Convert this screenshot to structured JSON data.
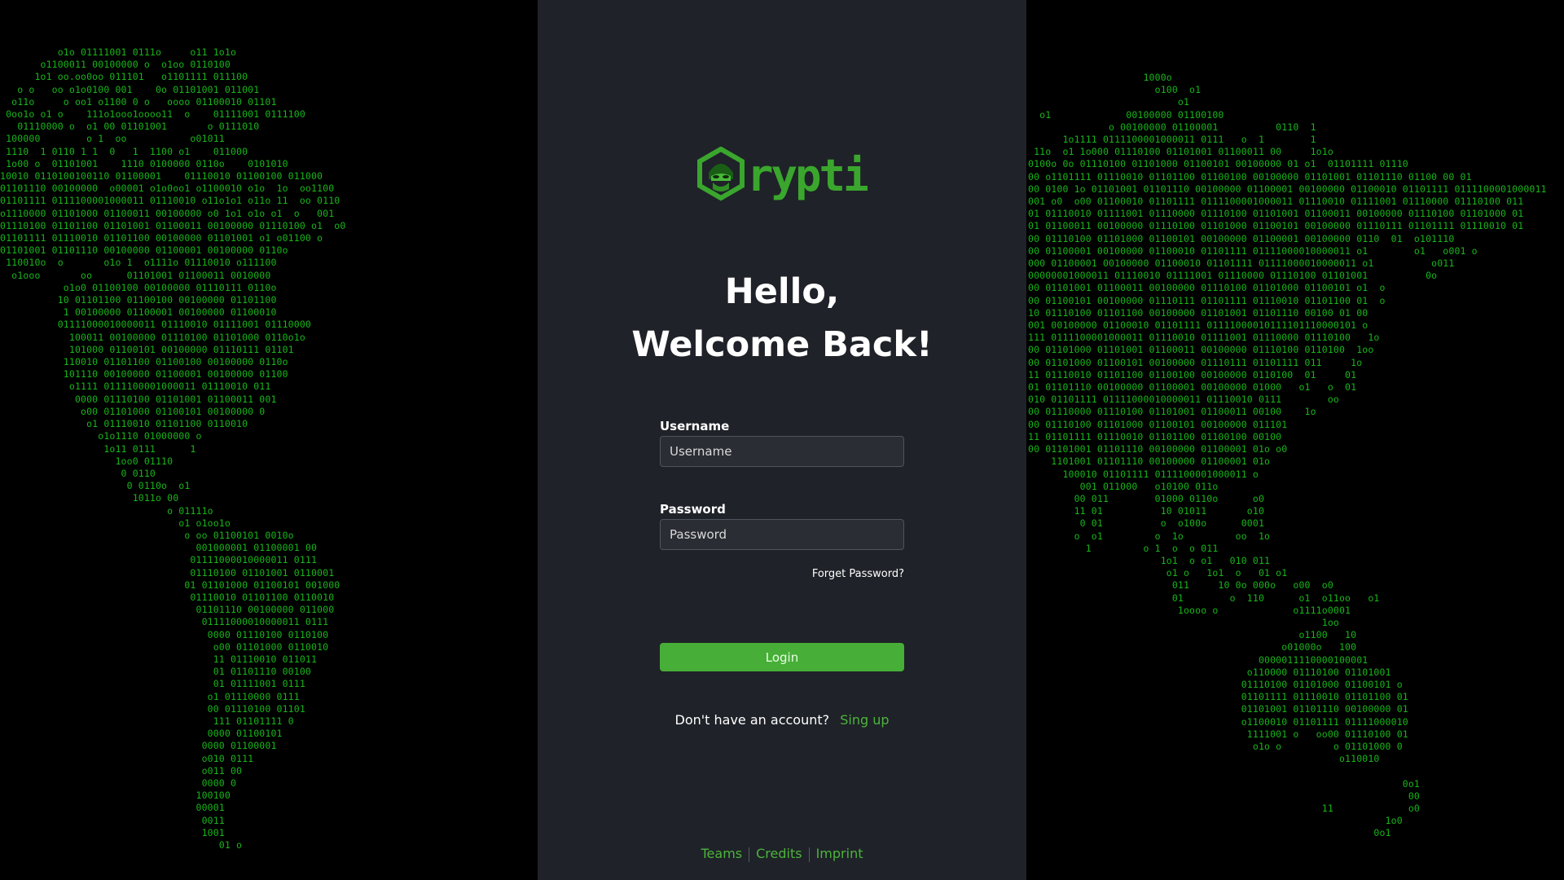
{
  "app": {
    "logo_text": "Cryptic",
    "accent_color": "#47ae37"
  },
  "greeting": {
    "line1": "Hello,",
    "line2": "Welcome Back!"
  },
  "form": {
    "username_label": "Username",
    "username_placeholder": "Username",
    "username_value": "",
    "password_label": "Password",
    "password_placeholder": "Password",
    "password_value": "",
    "forget_password": "Forget Password?",
    "login_label": "Login"
  },
  "signup": {
    "prompt": "Don't have an account?",
    "link": "Sing up"
  },
  "footer": {
    "links": [
      "Teams",
      "Credits",
      "Imprint"
    ]
  },
  "background": {
    "left_binary": [
      "          o1o 01111001 0111o     o11 1o1o",
      "       o1100011 00100000 o  o1oo 0110100",
      "      1o1 oo.oo0oo 011101   o1101111 011100",
      "   o o   oo o1o0100 001    0o 01101001 011001",
      "  o11o     o oo1 o1100 0 o   oooo 01100010 01101",
      " 0oo1o o1 o    111o1ooo1oooo11  o    01111001 0111100",
      "   01110000 o  o1 00 01101001       o 0111010",
      " 100000        o 1  oo           o01011",
      " 1110  1 0110 1 1  0   1  1100 o1    011000",
      " 1o00 o  01101001    1110 0100000 0110o    0101010",
      "10010 0110100100110 01100001    01110010 01100100 011000",
      "01101110 00100000  o00001 o1o0oo1 o1100010 o1o  1o  oo1100",
      "01101111 0111100001000011 01110010 o11o1o1 o11o 11  oo 0110",
      "o1110000 01101000 01100011 00100000 o0 1o1 o1o o1  o   001",
      "01110100 01101100 01101001 01100011 00100000 01110100 o1  o0",
      "01101111 01110010 01101100 00100000 01101001 o1 o01100 o",
      "01101001 01101110 00100000 01100001 00100000 0110o",
      " 110010o  o       o1o 1  o1111o 01110010 o111100",
      "  o1ooo       oo      01101001 01100011 0010000",
      "           o1o0 01100100 00100000 01110111 0110o",
      "          10 01101100 01100100 00100000 01101100",
      "           1 00100000 01100001 00100000 01100010",
      "          01111000010000011 01110010 01111001 01110000",
      "            100011 00100000 01110100 01101000 0110o1o",
      "            101000 01100101 00100000 01110111 01101",
      "           110010 01101100 01100100 00100000 0110o",
      "           101110 00100000 01100001 00100000 01100",
      "            o1111 0111100001000011 01110010 011",
      "             0000 01110100 01101001 01100011 001",
      "              o00 01101000 01100101 00100000 0",
      "               o1 01110010 01101100 0110010",
      "                 o1o1110 01000000 o",
      "                  1o11 0111      1",
      "                    1oo0 01110",
      "                     0 0110",
      "                      0 0110o  o1",
      "                       1011o 00",
      "                             o 01111o",
      "                               o1 o1oo1o",
      "                                o oo 01100101 0010o",
      "                                  001000001 01100001 00",
      "                                 01111000010000011 0111",
      "                                 01110100 01101001 0110001",
      "                                01 01101000 01100101 001000",
      "                                 01110010 01101100 0110010",
      "                                  01101110 00100000 011000",
      "                                   01111000010000011 0111",
      "                                    0000 01110100 0110100",
      "                                     o00 01101000 0110010",
      "                                     11 01110010 011011",
      "                                     01 01101110 00100",
      "                                     01 01111001 0111",
      "                                    o1 01110000 0111",
      "                                    00 01110100 01101",
      "                                     111 01101111 0",
      "                                    0000 01100101",
      "                                   0000 01100001",
      "                                   o010 0111",
      "                                   o011 00",
      "                                   0000 0",
      "                                  100100",
      "                                  00001",
      "                                   0011",
      "                                   1001",
      "                                      01 o"
    ],
    "right_binary": [
      "                    1000o",
      "                      o100  o1",
      "                          o1",
      "  o1             00100000 01100100",
      "              o 00100000 01100001          0110  1",
      "      1o1111 0111100001000011 0111   o  1        1",
      " 11o  o1 1o000 01110100 01101001 01100011 00     1o1o",
      "0100o 0o 01110100 01101000 01100101 00100000 01 o1  01101111 01110  ",
      "00 o1101111 01110010 01101100 01100100 00100000 01101001 01101110 01100 00 01",
      "00 0100 1o 01101001 01101110 00100000 01100001 00100000 01100010 01101111 0111100001000011",
      "001 o0  o00 01100010 01101111 0111100001000011 01110010 01111001 01110000 01110100 011",
      "01 01110010 01111001 01110000 01110100 01101001 01100011 00100000 01110100 01101000 01",
      "01 01100011 00100000 01110100 01101000 01100101 00100000 01110111 01101111 01110010 01",
      "00 01110100 01101000 01100101 00100000 01100001 00100000 0110  01  o101110",
      "00 01100001 00100000 01100010 01101111 01111000010000011 o1        o1   o001 o",
      "000 01100001 00100000 01100010 01101111 01111000010000011 o1          o011",
      "00000001000011 01110010 01111001 01110000 01110100 01101001          0o",
      "00 01101001 01100011 00100000 01110100 01101000 01100101 o1  o",
      "00 01100101 00100000 01110111 01101111 01110010 01101100 01  o",
      "10 01110100 01101100 00100000 01101001 01101110 00100 01 00",
      "001 00100000 01100010 01101111 01111000010111101110000101 o",
      "111 0111100001000011 01110010 01111001 01110000 01110100   1o",
      "00 01101000 01101001 01100011 00100000 01110100 0110100  1oo",
      "00 01101000 01100101 00100000 01110111 01101111 011     1o",
      "11 01110010 01101100 01100100 00100000 0110100  01     01",
      "01 01101110 00100000 01100001 00100000 01000   o1   o  01",
      "010 01101111 01111000010000011 01110010 0111        oo",
      "00 01110000 01110100 01101001 01100011 00100    1o",
      "00 01110100 01101000 01100101 00100000 011101",
      "11 01101111 01110010 01101100 01100100 00100",
      "00 01101001 01101110 00100000 01100001 01o o0",
      "    1101001 01101110 00100000 01100001 01o",
      "      100010 01101111 0111100001000011 o",
      "         001 011000   o10100 011o",
      "        00 011        01000 0110o      o0",
      "        11 01          10 01011       o10",
      "         0 01          o  o100o      0001",
      "        o  o1         o  1o         oo  1o",
      "          1         o 1  o  o 011",
      "                       1o1  o o1   010 011",
      "                        o1 o   1o1  o   01 o1",
      "                         011     10 0o 000o   o00  o0",
      "                         01        o  110      o1  o11oo   o1",
      "                          1oooo o             o1111o0001",
      "                                                   1oo",
      "                                               o1100   10",
      "                                            o01000o   100",
      "                                        0000011110000100001",
      "                                      o110000 01110100 01101001",
      "                                     01110100 01101000 01100101 o",
      "                                     01101111 01110010 01101100 01",
      "                                     01101001 01101110 00100000 01",
      "                                     o1100010 01101111 01111000010",
      "                                      1111001 o   oo00 01110100 01",
      "                                       o1o o         o 01101000 0",
      "                                                      o110010",
      "",
      "                                                                 0o1",
      "                                                                  00",
      "                                                   11             o0",
      "                                                              1o0",
      "                                                            0o1"
    ]
  }
}
